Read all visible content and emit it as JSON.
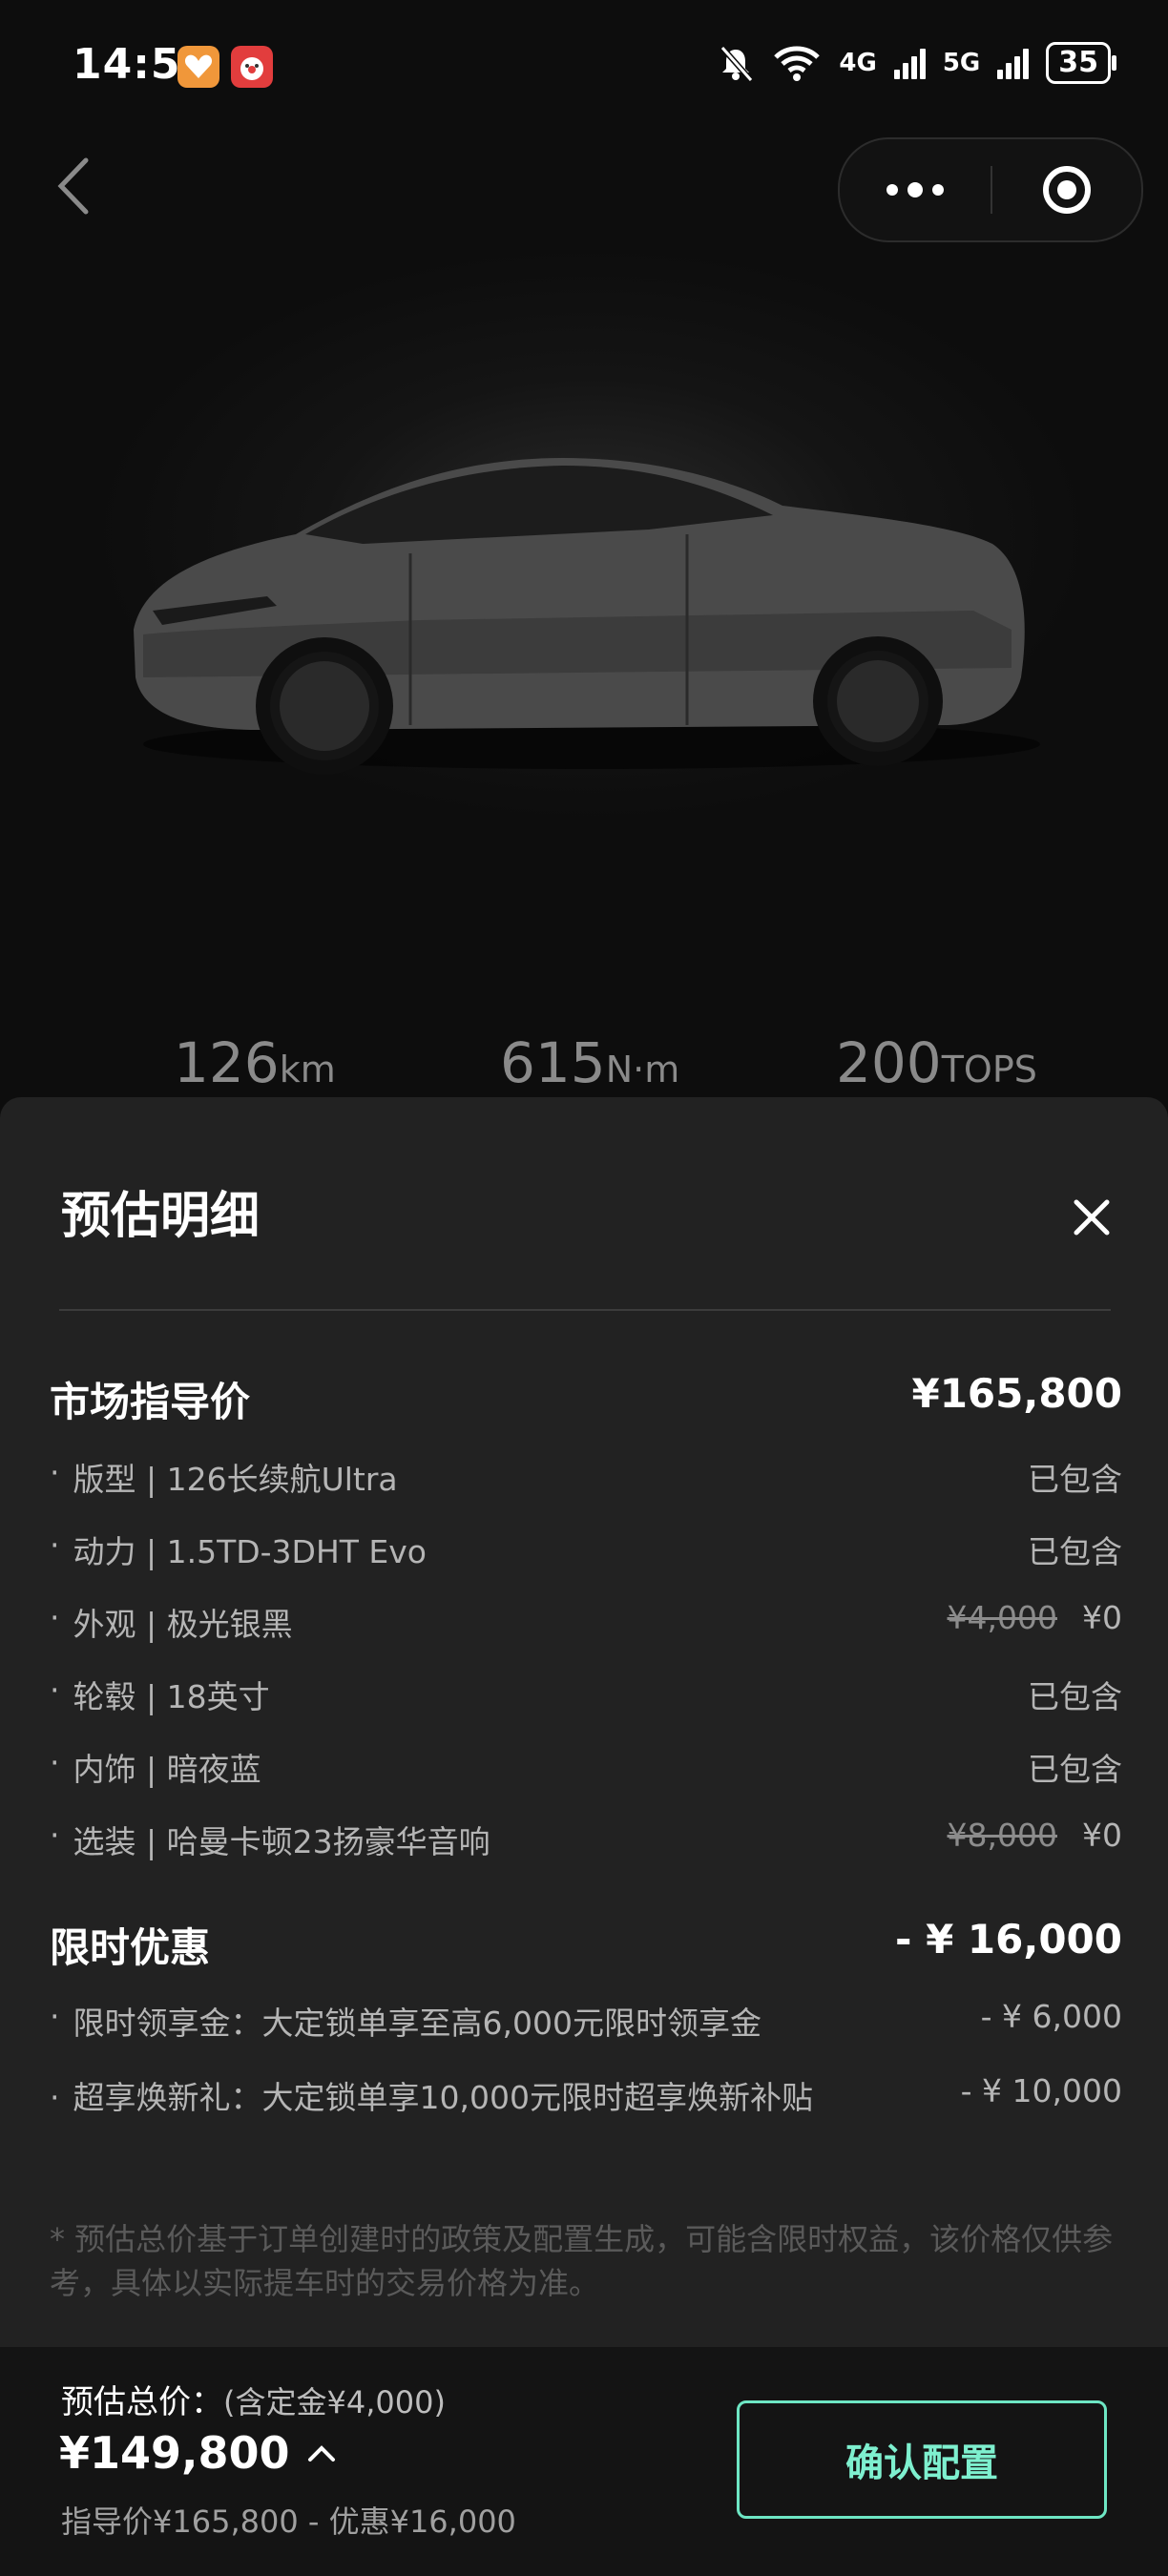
{
  "status_bar": {
    "time": "14:56",
    "net_1": "4G",
    "net_2": "5G",
    "battery": "35"
  },
  "hero": {
    "specs": [
      {
        "value": "126",
        "unit": "km"
      },
      {
        "value": "615",
        "unit": "N·m"
      },
      {
        "value": "200",
        "unit": "TOPS"
      }
    ]
  },
  "sheet": {
    "title": "预估明细",
    "guide": {
      "label": "市场指导价",
      "value": "¥165,800",
      "items": [
        {
          "label": "版型 | 126长续航Ultra",
          "value": "已包含"
        },
        {
          "label": "动力 | 1.5TD-3DHT Evo",
          "value": "已包含"
        },
        {
          "label": "外观 | 极光银黑",
          "original": "¥4,000",
          "value": "¥0"
        },
        {
          "label": "轮毂 | 18英寸",
          "value": "已包含"
        },
        {
          "label": "内饰 | 暗夜蓝",
          "value": "已包含"
        },
        {
          "label": "选装 | 哈曼卡顿23扬豪华音响",
          "original": "¥8,000",
          "value": "¥0"
        }
      ]
    },
    "discount": {
      "label": "限时优惠",
      "value": "- ¥ 16,000",
      "items": [
        {
          "label": "限时领享金：大定锁单享至高6,000元限时领享金",
          "value": "- ¥ 6,000"
        },
        {
          "label": "超享焕新礼：大定锁单享10,000元限时超享焕新补贴",
          "value": "- ¥ 10,000"
        }
      ]
    },
    "note": "* 预估总价基于订单创建时的政策及配置生成，可能含限时权益，该价格仅供参考，具体以实际提车时的交易价格为准。"
  },
  "bottom": {
    "total_label": "预估总价：",
    "deposit": "(含定金¥4,000)",
    "total_price": "¥149,800",
    "breakdown": "指导价¥165,800 - 优惠¥16,000",
    "confirm": "确认配置"
  },
  "colors": {
    "accent": "#6ee6c4",
    "sheet_bg": "#222222",
    "page_bg": "#0d0d0d"
  }
}
